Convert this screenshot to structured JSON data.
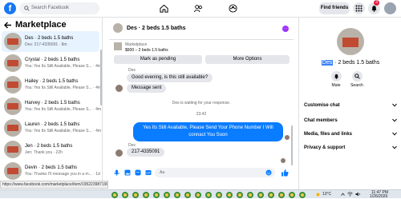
{
  "topbar": {
    "search_placeholder": "Search Facebook",
    "find_friends": "Find friends",
    "notifications_count": "3"
  },
  "sidebar": {
    "title": "Marketplace",
    "conversations": [
      {
        "name": "Des · 2 beds 1.5 baths",
        "sub": "Des: 217-4335091 · 8m"
      },
      {
        "name": "Crystal · 2 beds 1.5 baths",
        "sub": "You: Yes Its Still Available, Please S... · 4m"
      },
      {
        "name": "Hailey · 2 beds 1.5 baths",
        "sub": "You: Yes Its Still Available, Please S... · 4m"
      },
      {
        "name": "Harvey · 2 beds 1.5 baths",
        "sub": "You: Yes Its Still Available, Please S... · 4m"
      },
      {
        "name": "Lauren · 2 beds 1.5 baths",
        "sub": "You: Yes Its Still Available, Please S... · 4m"
      },
      {
        "name": "Jen · 2 beds 1.5 baths",
        "sub": "Jen: Thank you · 22h"
      },
      {
        "name": "Devin · 2 beds 1.5 baths",
        "sub": "You: Thanks I'll message you in a m... · 1d"
      }
    ]
  },
  "chat": {
    "title": "Des · 2 beds 1.5 baths",
    "listing_source": "Marketplace",
    "listing_price": "$600 – 2 beds 1.5 baths",
    "mark_pending": "Mark as pending",
    "more_options": "More Options",
    "messages": {
      "sender1": "Des",
      "msg1": "Good evening, is this still available?",
      "msg2": "Message sent",
      "waiting_note": "Des is waiting for your response.",
      "time_note": "23:42",
      "msg3": "Yes Its Still Available, Please Send Your Phone Number I Will connact You Soon",
      "sender2": "Des",
      "msg4": "217-4335091"
    },
    "composer_placeholder": "Aa"
  },
  "info": {
    "name_highlight": "Des",
    "name_rest": " · 2 beds 1.5 baths",
    "mute": "Mute",
    "search": "Search",
    "rows": [
      "Customise chat",
      "Chat members",
      "Media, files and links",
      "Privacy & support"
    ]
  },
  "statusbar": {
    "url": "https://www.facebook.com/marketplace/item/1952239871906266/?referralSurfac..."
  },
  "taskbar": {
    "temperature": "13°C",
    "time": "11:47 PM",
    "date": "1/26/2026"
  },
  "colors": {
    "brand": "#1877f2",
    "outgoing_bubble": "#0a7cff",
    "active_conversation": "#e7f3ff"
  }
}
